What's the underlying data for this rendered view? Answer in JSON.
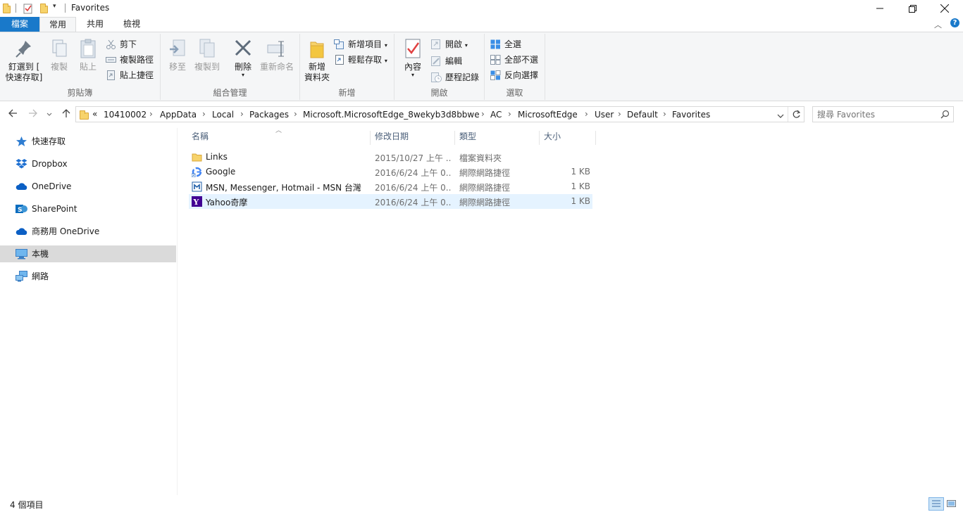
{
  "window": {
    "title": "Favorites"
  },
  "ribbon_tabs": {
    "file": "檔案",
    "home": "常用",
    "share": "共用",
    "view": "檢視"
  },
  "clipboard": {
    "pin_line1": "釘選到 [",
    "pin_line2": "快速存取]",
    "copy": "複製",
    "paste": "貼上",
    "cut": "剪下",
    "copy_path": "複製路徑",
    "paste_shortcut": "貼上捷徑",
    "label": "剪貼簿"
  },
  "organize": {
    "move_to": "移至",
    "copy_to": "複製到",
    "delete": "刪除",
    "rename": "重新命名",
    "label": "組合管理"
  },
  "new_group": {
    "new_folder_line1": "新增",
    "new_folder_line2": "資料夾",
    "new_item": "新增項目",
    "easy_access": "輕鬆存取",
    "label": "新增"
  },
  "open_group": {
    "properties": "內容",
    "open": "開啟",
    "edit": "編輯",
    "history": "歷程記錄",
    "label": "開啟"
  },
  "select_group": {
    "select_all": "全選",
    "select_none": "全部不選",
    "invert": "反向選擇",
    "label": "選取"
  },
  "address": {
    "overflow": "«",
    "crumbs": [
      "10410002",
      "AppData",
      "Local",
      "Packages",
      "Microsoft.MicrosoftEdge_8wekyb3d8bbwe",
      "AC",
      "MicrosoftEdge",
      "User",
      "Default",
      "Favorites"
    ]
  },
  "search": {
    "placeholder": "搜尋 Favorites"
  },
  "nav_pane": {
    "items": [
      {
        "label": "快速存取"
      },
      {
        "label": "Dropbox"
      },
      {
        "label": "OneDrive"
      },
      {
        "label": "SharePoint"
      },
      {
        "label": "商務用 OneDrive"
      },
      {
        "label": "本機"
      },
      {
        "label": "網路"
      }
    ]
  },
  "columns": {
    "name": "名稱",
    "date": "修改日期",
    "type": "類型",
    "size": "大小"
  },
  "files": [
    {
      "name": "Links",
      "date": "2015/10/27 上午 ...",
      "type": "檔案資料夾",
      "size": ""
    },
    {
      "name": "Google",
      "date": "2016/6/24 上午 0...",
      "type": "網際網路捷徑",
      "size": "1 KB"
    },
    {
      "name": "MSN, Messenger, Hotmail - MSN 台灣",
      "date": "2016/6/24 上午 0...",
      "type": "網際網路捷徑",
      "size": "1 KB"
    },
    {
      "name": "Yahoo奇摩",
      "date": "2016/6/24 上午 0...",
      "type": "網際網路捷徑",
      "size": "1 KB"
    }
  ],
  "status": {
    "count": "4 個項目"
  },
  "colors": {
    "accent": "#1979ca",
    "selection": "#e5f3ff",
    "nav_selected": "#dadada"
  }
}
